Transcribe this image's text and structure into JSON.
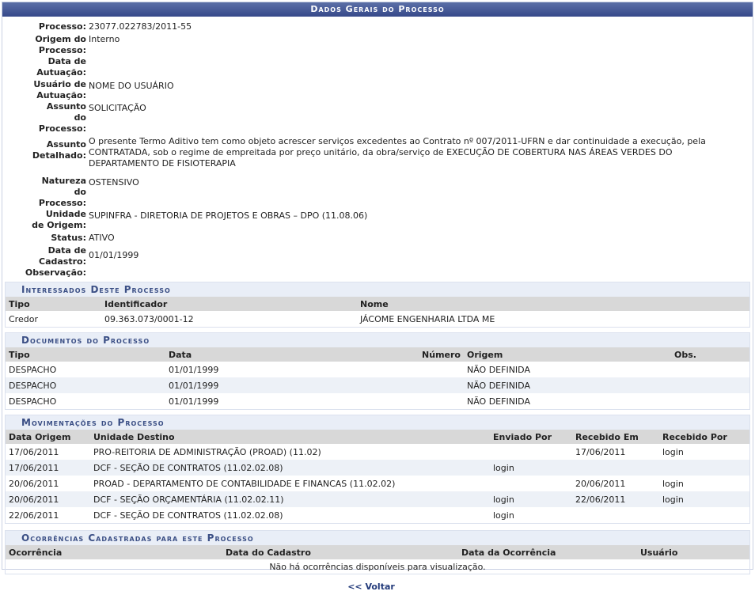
{
  "title": "Dados Gerais do Processo",
  "fields": [
    {
      "label": "Processo:",
      "value": "23077.022783/2011-55"
    },
    {
      "label": "Origem do Processo:",
      "value": "Interno"
    },
    {
      "label": "Data de Autuação:",
      "value": ""
    },
    {
      "label": "Usuário de Autuação:",
      "value": "NOME DO USUÁRIO"
    },
    {
      "label": "Assunto do Processo:",
      "value": "SOLICITAÇÃO"
    },
    {
      "label": "Assunto Detalhado:",
      "value": "O presente Termo Aditivo tem como objeto acrescer serviços excedentes ao Contrato nº 007/2011-UFRN e dar continuidade a execução, pela CONTRATADA, sob o regime de empreitada por preço unitário, da obra/serviço de EXECUÇÃO DE COBERTURA NAS ÁREAS VERDES DO DEPARTAMENTO DE FISIOTERAPIA"
    },
    {
      "label": "Natureza do Processo:",
      "value": "OSTENSIVO"
    },
    {
      "label": "Unidade de Origem:",
      "value": "SUPINFRA - DIRETORIA DE PROJETOS E OBRAS – DPO (11.08.06)"
    },
    {
      "label": "Status:",
      "value": "ATIVO"
    },
    {
      "label": "Data de Cadastro:",
      "value": "01/01/1999"
    },
    {
      "label": "Observação:",
      "value": ""
    }
  ],
  "interessados": {
    "title": "Interessados Deste Processo",
    "headers": [
      "Tipo",
      "Identificador",
      "Nome"
    ],
    "rows": [
      [
        "Credor",
        "09.363.073/0001-12",
        "JÁCOME ENGENHARIA LTDA ME"
      ]
    ]
  },
  "documentos": {
    "title": "Documentos do Processo",
    "headers": [
      "Tipo",
      "Data",
      "Número",
      "Origem",
      "Obs."
    ],
    "rows": [
      [
        "DESPACHO",
        "01/01/1999",
        "",
        "NÃO DEFINIDA",
        ""
      ],
      [
        "DESPACHO",
        "01/01/1999",
        "",
        "NÃO DEFINIDA",
        ""
      ],
      [
        "DESPACHO",
        "01/01/1999",
        "",
        "NÃO DEFINIDA",
        ""
      ]
    ]
  },
  "movimentacoes": {
    "title": "Movimentações do Processo",
    "headers": [
      "Data Origem",
      "Unidade Destino",
      "Enviado Por",
      "Recebido Em",
      "Recebido Por"
    ],
    "rows": [
      [
        "17/06/2011",
        "PRO-REITORIA DE ADMINISTRAÇÃO (PROAD) (11.02)",
        "",
        "17/06/2011",
        "login"
      ],
      [
        "17/06/2011",
        "DCF - SEÇÃO DE CONTRATOS (11.02.02.08)",
        "login",
        "",
        ""
      ],
      [
        "20/06/2011",
        "PROAD - DEPARTAMENTO DE CONTABILIDADE E FINANCAS (11.02.02)",
        "",
        "20/06/2011",
        "login"
      ],
      [
        "20/06/2011",
        "DCF - SEÇÃO ORÇAMENTÁRIA (11.02.02.11)",
        "login",
        "22/06/2011",
        "login"
      ],
      [
        "22/06/2011",
        "DCF - SEÇÃO DE CONTRATOS (11.02.02.08)",
        "login",
        "",
        ""
      ]
    ]
  },
  "ocorrencias": {
    "title": "Ocorrências Cadastradas para este Processo",
    "headers": [
      "Ocorrência",
      "Data do Cadastro",
      "Data da Ocorrência",
      "Usuário"
    ],
    "empty": "Não há ocorrências disponíveis para visualização."
  },
  "voltar": "<< Voltar"
}
